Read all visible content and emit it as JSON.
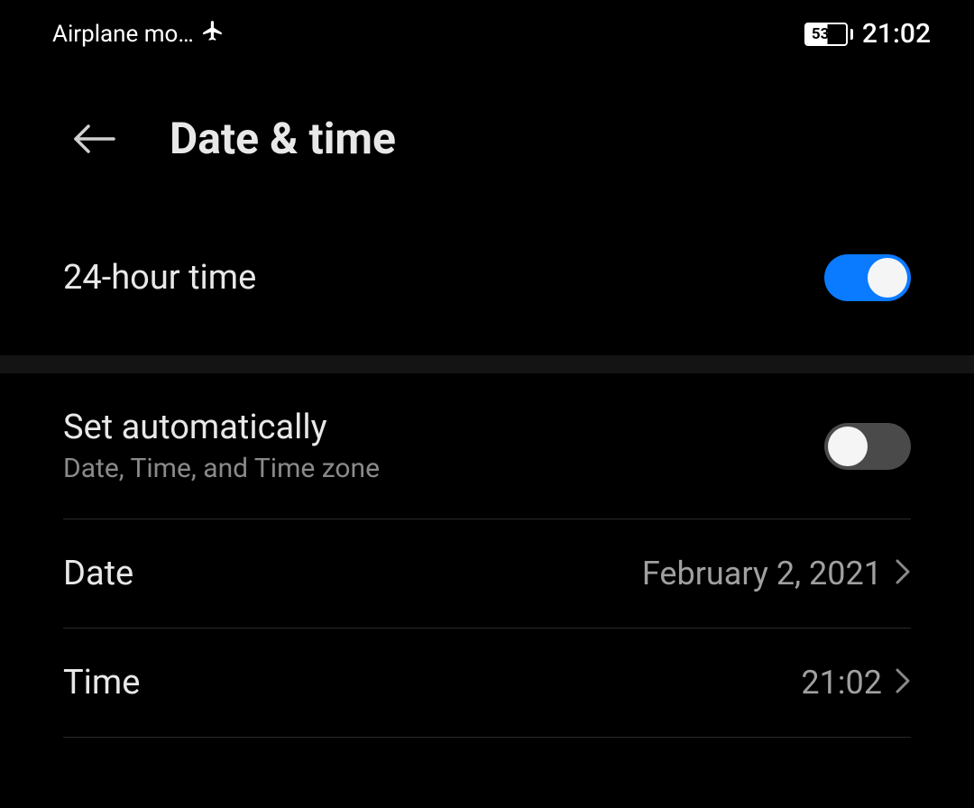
{
  "status": {
    "left_text": "Airplane mo…",
    "battery_level": "53",
    "clock": "21:02"
  },
  "header": {
    "title": "Date & time"
  },
  "rows": {
    "twenty_four_hour": {
      "label": "24-hour time"
    },
    "set_auto": {
      "label": "Set automatically",
      "subtitle": "Date, Time, and Time zone"
    },
    "date": {
      "label": "Date",
      "value": "February 2, 2021"
    },
    "time": {
      "label": "Time",
      "value": "21:02"
    }
  }
}
